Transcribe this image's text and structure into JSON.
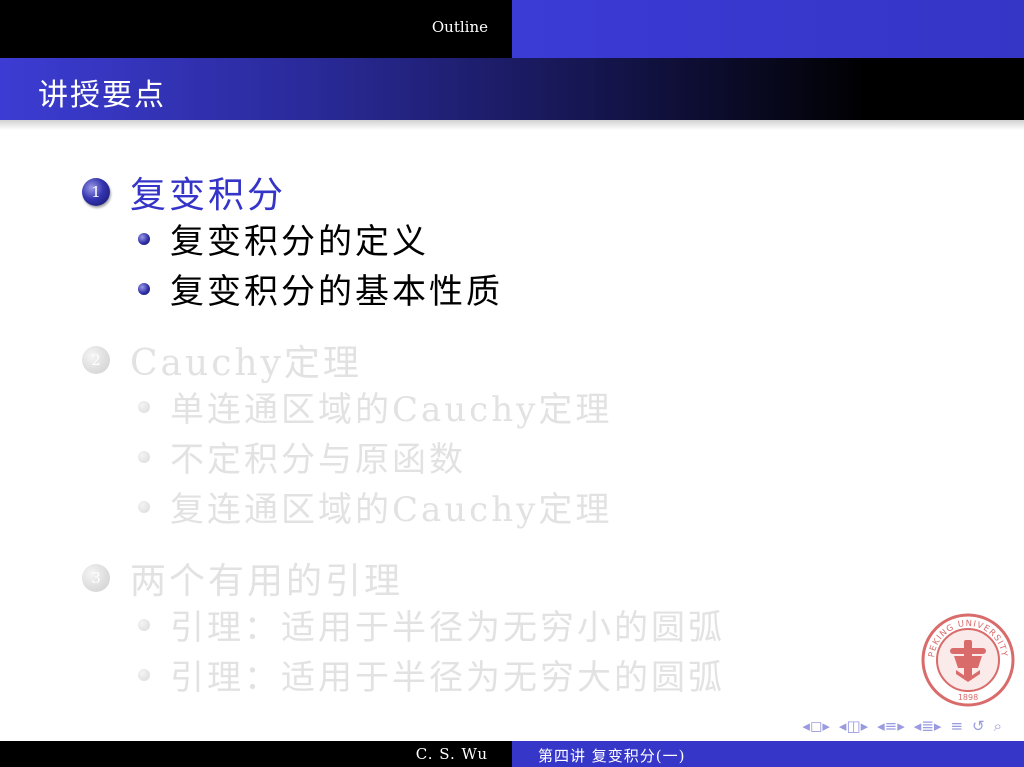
{
  "header": {
    "outline_label": "Outline"
  },
  "frame": {
    "title": "讲授要点"
  },
  "sections": [
    {
      "number": "1",
      "title": "复变积分",
      "items": [
        "复变积分的定义",
        "复变积分的基本性质"
      ]
    },
    {
      "number": "2",
      "title": "Cauchy定理",
      "items": [
        "单连通区域的Cauchy定理",
        "不定积分与原函数",
        "复连通区域的Cauchy定理"
      ]
    },
    {
      "number": "3",
      "title": "两个有用的引理",
      "items": [
        "引理：适用于半径为无穷小的圆弧",
        "引理：适用于半径为无穷大的圆弧"
      ]
    }
  ],
  "logo": {
    "top_text": "PEKING UNIVERSITY",
    "year": "1898"
  },
  "footer": {
    "author": "C. S. Wu",
    "lecture": "第四讲  复变积分(一)"
  },
  "colors": {
    "accent": "#3434c8",
    "faded": "#e2e2e2",
    "footer_right": "#3636c8"
  }
}
